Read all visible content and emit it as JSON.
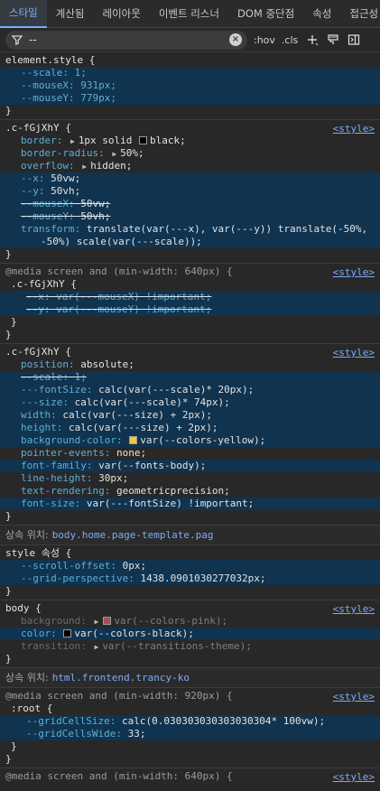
{
  "tabs": [
    "스타일",
    "계산됨",
    "레이아웃",
    "이벤트 리스너",
    "DOM 중단점",
    "속성",
    "접근성"
  ],
  "filter": {
    "value": "--",
    "hov": ":hov",
    "cls": ".cls"
  },
  "rules": {
    "element": {
      "selector": "element.style {",
      "lines": [
        "--scale: 1;",
        "--mouseX: 931px;",
        "--mouseY: 779px;"
      ],
      "close": "}"
    },
    "r1": {
      "selector": ".c-fGjXhY {",
      "source": "<style>",
      "border_prop": "border:",
      "border_val": "1px solid",
      "border_color": "black;",
      "radius_prop": "border-radius:",
      "radius_val": "50%;",
      "overflow_prop": "overflow:",
      "overflow_val": "hidden;",
      "x_prop": "--x:",
      "x_val": "50vw;",
      "y_prop": "--y:",
      "y_val": "50vh;",
      "mousex_prop": "--mouseX:",
      "mousex_val": "50vw;",
      "mousey_prop": "--mouseY:",
      "mousey_val": "50vh;",
      "transform_prop": "transform:",
      "transform_val": "translate(var(---x), var(---y)) translate(-50%,",
      "transform_cont": "-50%) scale(var(---scale));",
      "close": "}"
    },
    "r2": {
      "media": "@media screen and (min-width: 640px) {",
      "source": "<style>",
      "selector": ".c-fGjXhY {",
      "x_line": "--x: var(---mouseX) !important;",
      "y_line": "--y: var(---mouseY) !important;",
      "close1": "}",
      "close2": "}"
    },
    "r3": {
      "selector": ".c-fGjXhY {",
      "source": "<style>",
      "l1_prop": "position:",
      "l1_val": "absolute;",
      "l2": "--scale: 1;",
      "l3_prop": "---fontSize:",
      "l3_val": "calc(var(---scale)* 20px);",
      "l4_prop": "---size:",
      "l4_val": "calc(var(---scale)* 74px);",
      "l5_prop": "width:",
      "l5_val": "calc(var(---size) + 2px);",
      "l6_prop": "height:",
      "l6_val": "calc(var(---size) + 2px);",
      "l7_prop": "background-color:",
      "l7_val": "var(--colors-yellow);",
      "l8_prop": "pointer-events:",
      "l8_val": "none;",
      "l9_prop": "font-family:",
      "l9_val": "var(--fonts-body);",
      "l10_prop": "line-height:",
      "l10_val": "30px;",
      "l11_prop": "text-rendering:",
      "l11_val": "geometricprecision;",
      "l12_prop": "font-size:",
      "l12_val": "var(---fontSize) !important;",
      "close": "}",
      "swatch_color": "#f5c542"
    },
    "inherit1": {
      "label": "상속 위치:",
      "link": "body.home.page-template.pag"
    },
    "r4": {
      "selector": "style 속성 {",
      "l1_prop": "--scroll-offset:",
      "l1_val": "0px;",
      "l2_prop": "--grid-perspective:",
      "l2_val": "1438.0901030277032px;",
      "close": "}"
    },
    "r5": {
      "selector": "body {",
      "source": "<style>",
      "l1_prop": "background:",
      "l1_val": "var(--colors-pink);",
      "l2_prop": "color:",
      "l2_val": "var(--colors-black);",
      "l3_prop": "transition:",
      "l3_val": "var(--transitions-theme);",
      "close": "}",
      "pink": "#a94b5a",
      "black": "#000000"
    },
    "inherit2": {
      "label": "상속 위치:",
      "link": "html.frontend.trancy-ko"
    },
    "r6": {
      "media": "@media screen and (min-width: 920px) {",
      "source": "<style>",
      "selector": ":root {",
      "l1_prop": "--gridCellSize:",
      "l1_val": "calc(0.030303030303030304* 100vw);",
      "l2_prop": "--gridCellsWide:",
      "l2_val": "33;",
      "close1": "}",
      "close2": "}"
    },
    "r7": {
      "media": "@media screen and (min-width: 640px) {",
      "source": "<style>"
    }
  }
}
